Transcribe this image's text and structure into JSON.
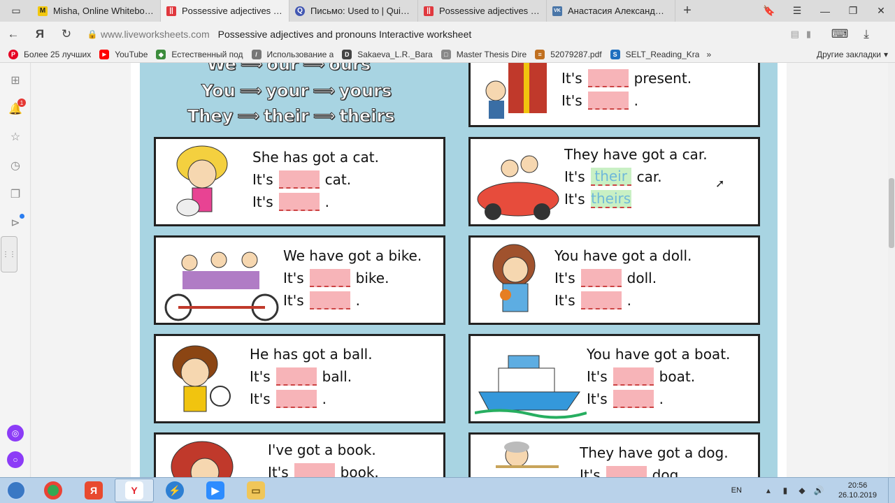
{
  "tabs": [
    {
      "title": "Misha, Online Whiteboard f",
      "fav": "M",
      "color": "#f2c80f",
      "active": false
    },
    {
      "title": "Possessive adjectives and",
      "fav": "||",
      "color": "#e0383e",
      "active": true
    },
    {
      "title": "Письмо: Used to | Quizlet",
      "fav": "Q",
      "color": "#4257b2",
      "active": false
    },
    {
      "title": "Possessive adjectives and p",
      "fav": "||",
      "color": "#e0383e",
      "active": false
    },
    {
      "title": "Анастасия Александровна",
      "fav": "VK",
      "color": "#4a76a8",
      "active": false
    }
  ],
  "address": {
    "host": "www.liveworksheets.com",
    "page_title": "Possessive adjectives and pronouns Interactive worksheet"
  },
  "bookmarks": [
    {
      "label": "Более 25 лучших",
      "fav": "P",
      "color": "#e60023"
    },
    {
      "label": "YouTube",
      "fav": "▶",
      "color": "#ff0000"
    },
    {
      "label": "Естественный под",
      "fav": "◆",
      "color": "#3c8c3c"
    },
    {
      "label": "Использование а",
      "fav": "/",
      "color": "#777777"
    },
    {
      "label": "Sakaeva_L.R._Bara",
      "fav": "D",
      "color": "#444444"
    },
    {
      "label": "Master Thesis Dire",
      "fav": "□",
      "color": "#888888"
    },
    {
      "label": "52079287.pdf",
      "fav": "≡",
      "color": "#c07020"
    },
    {
      "label": "SELT_Reading_Kra",
      "fav": "S",
      "color": "#1f6fbf"
    }
  ],
  "bookmarks_more": "»",
  "bookmarks_other": "Другие закладки",
  "sidebar": {
    "notification_count": "1"
  },
  "worksheet": {
    "chart_rows": [
      {
        "pronoun": "We",
        "adjective": "our",
        "possessive": "ours"
      },
      {
        "pronoun": "You",
        "adjective": "your",
        "possessive": "yours"
      },
      {
        "pronoun": "They",
        "adjective": "their",
        "possessive": "theirs"
      }
    ],
    "cards": [
      {
        "id": "present",
        "sentence": "",
        "line2_pre": "It's",
        "line2_post": "present.",
        "line3_pre": "It's",
        "line3_post": ".",
        "answer1": "",
        "answer2": ""
      },
      {
        "id": "cat",
        "sentence": "She has got a cat.",
        "line2_pre": "It's",
        "line2_post": "cat.",
        "line3_pre": "It's",
        "line3_post": ".",
        "answer1": "",
        "answer2": ""
      },
      {
        "id": "car",
        "sentence": "They have got a car.",
        "line2_pre": "It's",
        "line2_post": "car.",
        "line3_pre": "It's",
        "line3_post": "",
        "answer1": "their",
        "answer2": "theirs"
      },
      {
        "id": "bike",
        "sentence": "We have got a bike.",
        "line2_pre": "It's",
        "line2_post": "bike.",
        "line3_pre": "It's",
        "line3_post": ".",
        "answer1": "",
        "answer2": ""
      },
      {
        "id": "doll",
        "sentence": "You have got a doll.",
        "line2_pre": "It's",
        "line2_post": "doll.",
        "line3_pre": "It's",
        "line3_post": ".",
        "answer1": "",
        "answer2": ""
      },
      {
        "id": "ball",
        "sentence": "He has got a ball.",
        "line2_pre": "It's",
        "line2_post": "ball.",
        "line3_pre": "It's",
        "line3_post": ".",
        "answer1": "",
        "answer2": ""
      },
      {
        "id": "boat",
        "sentence": "You have got a boat.",
        "line2_pre": "It's",
        "line2_post": "boat.",
        "line3_pre": "It's",
        "line3_post": ".",
        "answer1": "",
        "answer2": ""
      },
      {
        "id": "book",
        "sentence": "I've got a book.",
        "line2_pre": "It's",
        "line2_post": "book.",
        "line3_pre": "",
        "line3_post": "",
        "answer1": "",
        "answer2": ""
      },
      {
        "id": "dog",
        "sentence": "They have got a dog.",
        "line2_pre": "It's",
        "line2_post": "dog.",
        "line3_pre": "",
        "line3_post": "",
        "answer1": "",
        "answer2": ""
      }
    ]
  },
  "taskbar": {
    "lang": "EN",
    "time": "20:56",
    "date": "26.10.2019"
  }
}
